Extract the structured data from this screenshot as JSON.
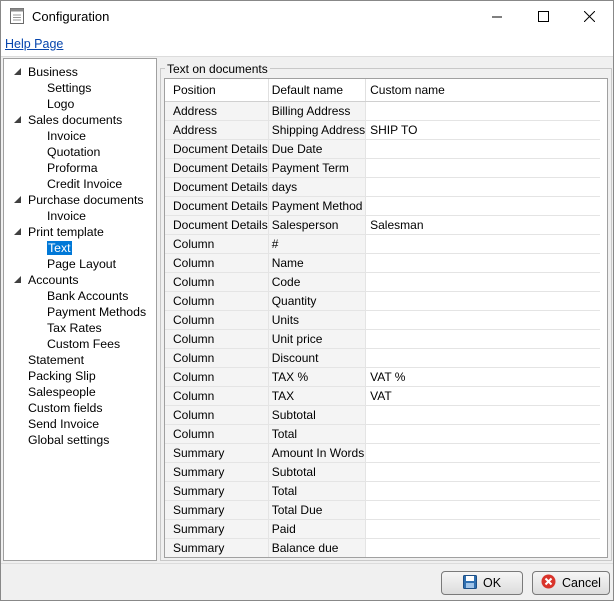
{
  "window": {
    "title": "Configuration"
  },
  "menu": {
    "help": "Help Page"
  },
  "tree": [
    {
      "label": "Business",
      "level": 0,
      "expanded": true
    },
    {
      "label": "Settings",
      "level": 1
    },
    {
      "label": "Logo",
      "level": 1
    },
    {
      "label": "Sales documents",
      "level": 0,
      "expanded": true
    },
    {
      "label": "Invoice",
      "level": 1
    },
    {
      "label": "Quotation",
      "level": 1
    },
    {
      "label": "Proforma",
      "level": 1
    },
    {
      "label": "Credit Invoice",
      "level": 1
    },
    {
      "label": "Purchase documents",
      "level": 0,
      "expanded": true
    },
    {
      "label": "Invoice",
      "level": 1
    },
    {
      "label": "Print template",
      "level": 0,
      "expanded": true
    },
    {
      "label": "Text",
      "level": 1,
      "selected": true
    },
    {
      "label": "Page Layout",
      "level": 1
    },
    {
      "label": "Accounts",
      "level": 0,
      "expanded": true
    },
    {
      "label": "Bank Accounts",
      "level": 1
    },
    {
      "label": "Payment Methods",
      "level": 1
    },
    {
      "label": "Tax Rates",
      "level": 1
    },
    {
      "label": "Custom Fees",
      "level": 1
    },
    {
      "label": "Statement",
      "level": 0
    },
    {
      "label": "Packing Slip",
      "level": 0
    },
    {
      "label": "Salespeople",
      "level": 0
    },
    {
      "label": "Custom fields",
      "level": 0
    },
    {
      "label": "Send Invoice",
      "level": 0
    },
    {
      "label": "Global settings",
      "level": 0
    }
  ],
  "group_title": "Text on documents",
  "table": {
    "headers": [
      "Position",
      "Default name",
      "Custom name"
    ],
    "rows": [
      [
        "Address",
        "Billing Address",
        ""
      ],
      [
        "Address",
        "Shipping Address",
        "SHIP TO"
      ],
      [
        "Document Details",
        "Due Date",
        ""
      ],
      [
        "Document Details",
        "Payment Term",
        ""
      ],
      [
        "Document Details",
        "days",
        ""
      ],
      [
        "Document Details",
        "Payment Method",
        ""
      ],
      [
        "Document Details",
        "Salesperson",
        "Salesman"
      ],
      [
        "Column",
        "#",
        ""
      ],
      [
        "Column",
        "Name",
        ""
      ],
      [
        "Column",
        "Code",
        ""
      ],
      [
        "Column",
        "Quantity",
        ""
      ],
      [
        "Column",
        "Units",
        ""
      ],
      [
        "Column",
        "Unit price",
        ""
      ],
      [
        "Column",
        "Discount",
        ""
      ],
      [
        "Column",
        "TAX %",
        "VAT %"
      ],
      [
        "Column",
        "TAX",
        "VAT"
      ],
      [
        "Column",
        "Subtotal",
        ""
      ],
      [
        "Column",
        "Total",
        ""
      ],
      [
        "Summary",
        "Amount In Words",
        ""
      ],
      [
        "Summary",
        "Subtotal",
        ""
      ],
      [
        "Summary",
        "Total",
        ""
      ],
      [
        "Summary",
        "Total Due",
        ""
      ],
      [
        "Summary",
        "Paid",
        ""
      ],
      [
        "Summary",
        "Balance due",
        ""
      ]
    ]
  },
  "buttons": {
    "ok": "OK",
    "cancel": "Cancel"
  },
  "colors": {
    "selection": "#0078d7",
    "link": "#0645ad",
    "ok_icon": "#2f6fb0",
    "cancel_icon": "#d9342b"
  },
  "icons": {
    "app": "document-icon",
    "ok": "save-icon",
    "cancel": "cancel-icon"
  }
}
